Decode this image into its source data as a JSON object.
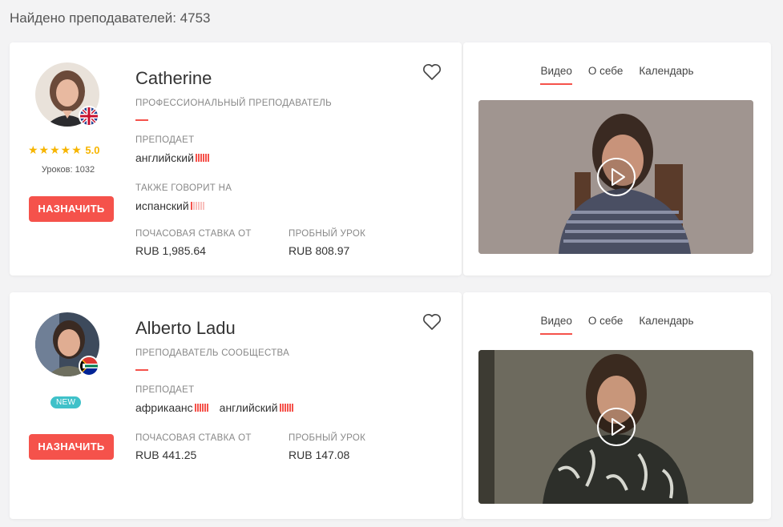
{
  "header": {
    "found_text": "Найдено преподавателей: 4753"
  },
  "teachers": [
    {
      "name": "Catherine",
      "kind": "ПРОФЕССИОНАЛЬНЫЙ ПРЕПОДАВАТЕЛЬ",
      "rating": "5.0",
      "stars": "★★★★★",
      "lessons": "Уроков: 1032",
      "book_label": "НАЗНАЧИТЬ",
      "teaches_label": "ПРЕПОДАЕТ",
      "teaches": [
        {
          "lang": "английский",
          "level": "native"
        }
      ],
      "also_label": "ТАКЖЕ ГОВОРИТ НА",
      "also": [
        {
          "lang": "испанский",
          "level": "beginner"
        }
      ],
      "rate_label": "ПОЧАСОВАЯ СТАВКА ОТ",
      "rate": "RUB 1,985.64",
      "trial_label": "ПРОБНЫЙ УРОК",
      "trial": "RUB 808.97",
      "flag_icon": "uk-flag-icon",
      "tabs": [
        "Видео",
        "О себе",
        "Календарь"
      ],
      "active_tab": "Видео"
    },
    {
      "name": "Alberto Ladu",
      "kind": "ПРЕПОДАВАТЕЛЬ СООБЩЕСТВА",
      "badge": "NEW",
      "book_label": "НАЗНАЧИТЬ",
      "teaches_label": "ПРЕПОДАЕТ",
      "teaches": [
        {
          "lang": "африкаанс",
          "level": "native"
        },
        {
          "lang": "английский",
          "level": "native"
        }
      ],
      "rate_label": "ПОЧАСОВАЯ СТАВКА ОТ",
      "rate": "RUB 441.25",
      "trial_label": "ПРОБНЫЙ УРОК",
      "trial": "RUB 147.08",
      "flag_icon": "south-africa-flag-icon",
      "tabs": [
        "Видео",
        "О себе",
        "Календарь"
      ],
      "active_tab": "Видео"
    }
  ],
  "colors": {
    "accent": "#f5524b",
    "star": "#f7b500",
    "new_badge": "#3fc1c9"
  }
}
